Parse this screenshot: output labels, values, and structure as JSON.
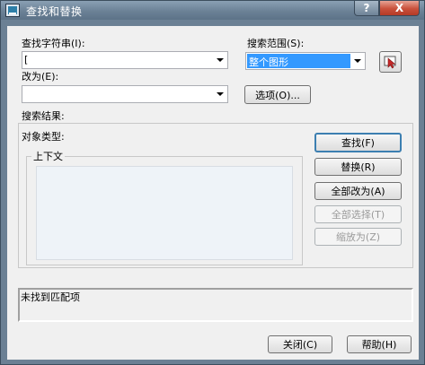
{
  "window": {
    "title": "查找和替换",
    "help_glyph": "?",
    "close_glyph": "X"
  },
  "find": {
    "label": "查找字符串(I):",
    "value": "["
  },
  "scope": {
    "label": "搜索范围(S):",
    "value": "整个图形"
  },
  "replace": {
    "label": "改为(E):",
    "value": ""
  },
  "options_button": "选项(O)...",
  "results": {
    "label": "搜索结果:",
    "object_type_label": "对象类型:",
    "context_label": "上下文"
  },
  "buttons": {
    "find": "查找(F)",
    "replace": "替换(R)",
    "replace_all": "全部改为(A)",
    "select_all": "全部选择(T)",
    "zoom_to": "缩放为(Z)",
    "close": "关闭(C)",
    "help": "帮助(H)"
  },
  "status": {
    "message": "未找到匹配项"
  },
  "icons": {
    "app": "autocad-app-icon",
    "pick": "select-objects-icon"
  },
  "colors": {
    "selection_highlight": "#3399ff",
    "default_button_border": "#3c7fb1"
  }
}
